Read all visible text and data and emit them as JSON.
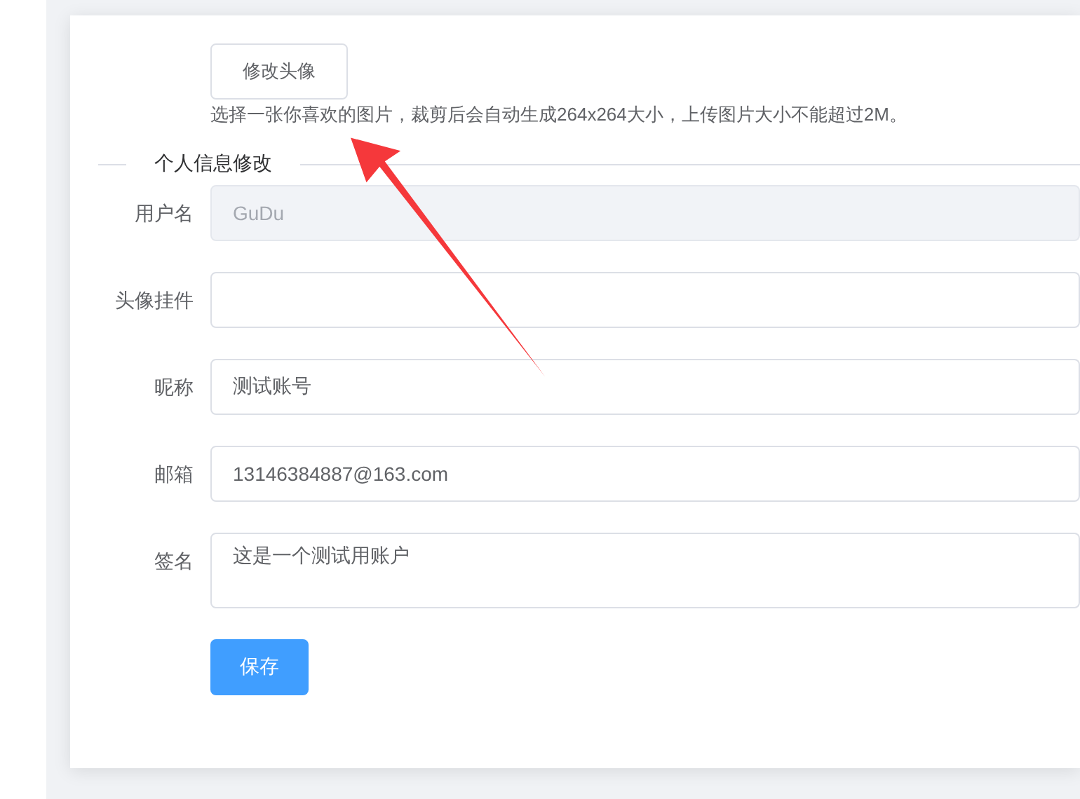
{
  "avatar": {
    "button": "修改头像",
    "hint": "选择一张你喜欢的图片，裁剪后会自动生成264x264大小，上传图片大小不能超过2M。"
  },
  "section_title": "个人信息修改",
  "fields": [
    {
      "label": "用户名",
      "kind": "input",
      "value": "GuDu",
      "disabled": true
    },
    {
      "label": "头像挂件",
      "kind": "input",
      "disabled": false
    },
    {
      "label": "昵称",
      "kind": "input",
      "value": "测试账号",
      "disabled": false
    },
    {
      "label": "邮箱",
      "kind": "input",
      "value": "13146384887@163.com",
      "disabled": false
    },
    {
      "label": "签名",
      "kind": "textarea",
      "value": "这是一个测试用账户",
      "disabled": false
    }
  ],
  "save_button": "保存"
}
